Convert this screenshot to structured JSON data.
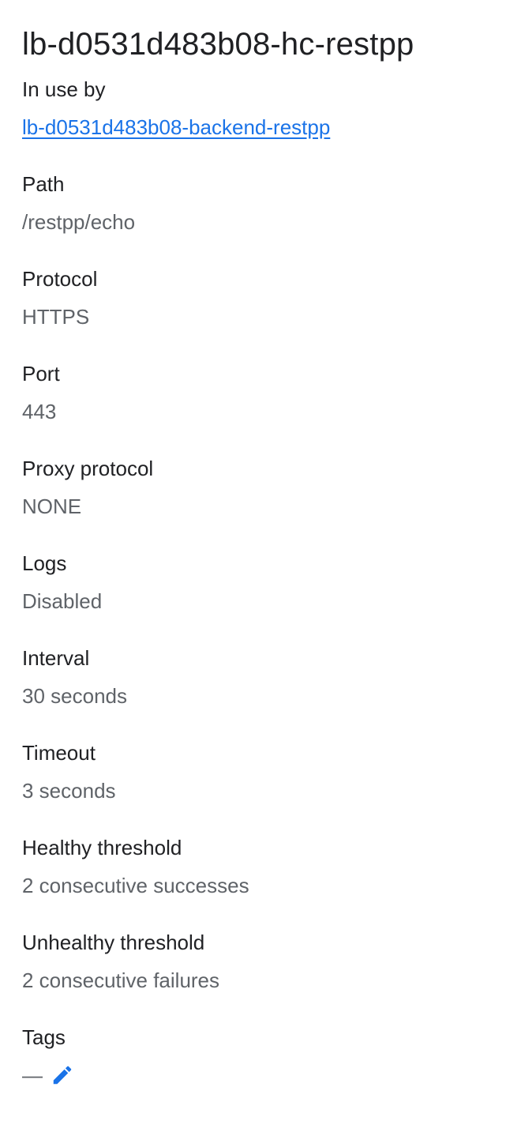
{
  "header": {
    "title": "lb-d0531d483b08-hc-restpp"
  },
  "in_use_by": {
    "label": "In use by",
    "link_text": "lb-d0531d483b08-backend-restpp"
  },
  "details": {
    "path": {
      "label": "Path",
      "value": "/restpp/echo"
    },
    "protocol": {
      "label": "Protocol",
      "value": "HTTPS"
    },
    "port": {
      "label": "Port",
      "value": "443"
    },
    "proxy_protocol": {
      "label": "Proxy protocol",
      "value": "NONE"
    },
    "logs": {
      "label": "Logs",
      "value": "Disabled"
    },
    "interval": {
      "label": "Interval",
      "value": "30 seconds"
    },
    "timeout": {
      "label": "Timeout",
      "value": "3 seconds"
    },
    "healthy_threshold": {
      "label": "Healthy threshold",
      "value": "2 consecutive successes"
    },
    "unhealthy_threshold": {
      "label": "Unhealthy threshold",
      "value": "2 consecutive failures"
    }
  },
  "tags": {
    "label": "Tags",
    "value": "—",
    "edit_icon": "pencil-icon"
  },
  "colors": {
    "text_primary": "#202124",
    "text_secondary": "#5f6368",
    "link": "#1a73e8"
  }
}
